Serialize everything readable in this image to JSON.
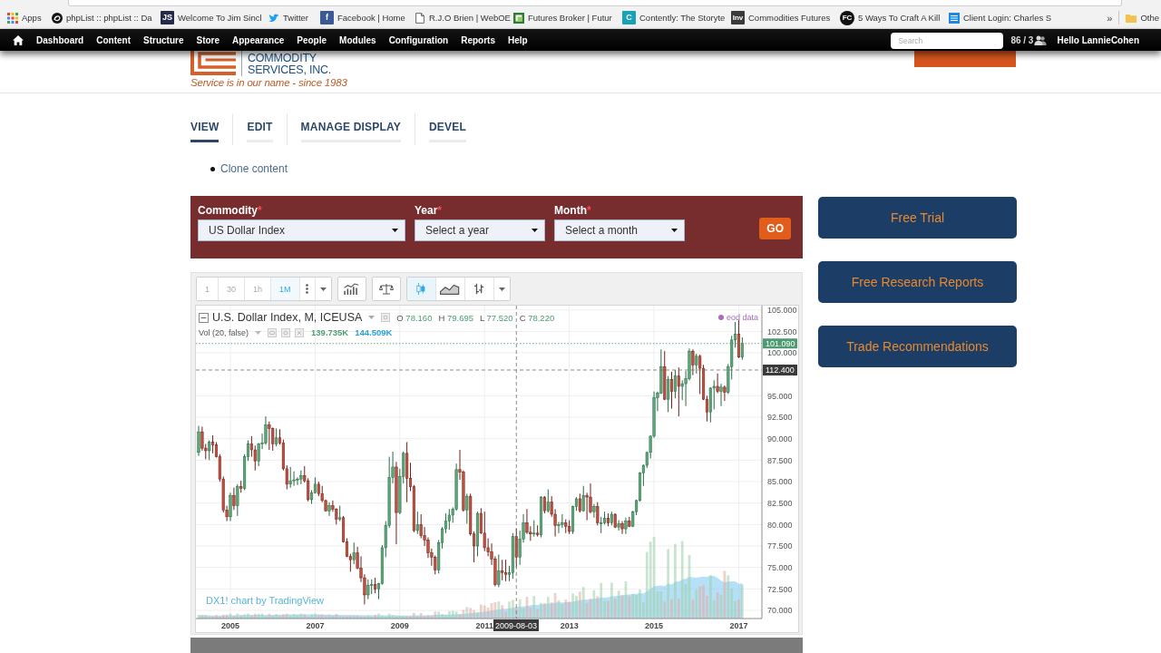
{
  "browser": {
    "bookmarks": [
      {
        "label": "Apps"
      },
      {
        "label": "phpList :: phpList :: Da"
      },
      {
        "label": "Welcome To Jim Sincl",
        "badge": "JS"
      },
      {
        "label": "Twitter"
      },
      {
        "label": "Facebook | Home",
        "badge": "f"
      },
      {
        "label": "R.J.O Brien | WebOE"
      },
      {
        "label": "Futures Broker | Futur"
      },
      {
        "label": "Contently: The Storyte",
        "badge": "C"
      },
      {
        "label": "Commodities Futures",
        "badge": "Inv"
      },
      {
        "label": "5 Ways To Craft A Kill",
        "badge": "FC"
      },
      {
        "label": "Client Login: Charles S"
      }
    ],
    "overflow": "»",
    "other_bookmarks": "Othe"
  },
  "admin_toolbar": {
    "items": [
      "Dashboard",
      "Content",
      "Structure",
      "Store",
      "Appearance",
      "People",
      "Modules",
      "Configuration",
      "Reports",
      "Help"
    ],
    "search": {
      "placeholder": "Search"
    },
    "online_count": "86 / 3",
    "greeting": "Hello LannieCohen"
  },
  "header": {
    "logo": {
      "name_lines": [
        "COMMODITY",
        "SERVICES, INC."
      ],
      "tagline": "Service is in our name - since 1983"
    }
  },
  "tabs": [
    {
      "label": "VIEW",
      "selected": true
    },
    {
      "label": "EDIT",
      "selected": false
    },
    {
      "label": "MANAGE DISPLAY",
      "selected": false
    },
    {
      "label": "DEVEL",
      "selected": false
    }
  ],
  "links": [
    "Clone content"
  ],
  "search_form": {
    "fields": [
      {
        "label": "Commodity",
        "required_mark": "*",
        "value": "US Dollar Index"
      },
      {
        "label": "Year",
        "required_mark": "*",
        "value": "Select a year"
      },
      {
        "label": "Month",
        "required_mark": "*",
        "value": "Select a month"
      }
    ],
    "submit": "GO"
  },
  "sidebar_buttons": [
    "Free Trial",
    "Free Research Reports",
    "Trade Recommendations"
  ],
  "chart_widget": {
    "intervals": [
      {
        "label": "1",
        "selected": false
      },
      {
        "label": "30",
        "selected": false
      },
      {
        "label": "1h",
        "selected": false
      },
      {
        "label": "1M",
        "selected": true
      }
    ],
    "chart_types": [
      {
        "kind": "candles",
        "selected": true
      },
      {
        "kind": "area",
        "selected": false
      },
      {
        "kind": "bars",
        "selected": false
      }
    ],
    "legend": {
      "title": "U.S. Dollar Index, M, ICEUSA",
      "ohlc": [
        {
          "label": "O",
          "value": "78.160"
        },
        {
          "label": "H",
          "value": "79.695"
        },
        {
          "label": "L",
          "value": "77.520"
        },
        {
          "label": "C",
          "value": "78.220"
        }
      ]
    },
    "volume": {
      "label": "Vol (20, false)",
      "values": [
        {
          "value": "139.735K",
          "color": "#4f9d70"
        },
        {
          "value": "144.509K",
          "color": "#2a9fd8"
        }
      ]
    },
    "data_source": {
      "label": "eod data",
      "color": "#a66bbd"
    },
    "attribution": "DX1! chart by TradingView",
    "crosshair": {
      "price_label": "112.400",
      "date_label": "2009-08-03"
    },
    "chart_data": [
      {
        "type": "candlestick",
        "grid": true,
        "xlim": [
          "2004-03-08",
          "2017-07-18"
        ],
        "ylim": [
          69.05,
          105.5
        ],
        "xticks": [
          {
            "value": "2005-01-01",
            "label": "2005"
          },
          {
            "value": "2007-01-01",
            "label": "2007"
          },
          {
            "value": "2009-01-01",
            "label": "2009"
          },
          {
            "value": "2011-01-01",
            "label": "2011"
          },
          {
            "value": "2013-01-01",
            "label": "2013"
          },
          {
            "value": "2015-01-01",
            "label": "2015"
          },
          {
            "value": "2017-01-01",
            "label": "2017"
          }
        ],
        "yticks": [
          {
            "value": 70,
            "label": "70.000"
          },
          {
            "value": 72.5,
            "label": "72.500"
          },
          {
            "value": 75,
            "label": "75.000"
          },
          {
            "value": 77.5,
            "label": "77.500"
          },
          {
            "value": 80,
            "label": "80.000"
          },
          {
            "value": 82.5,
            "label": "82.500"
          },
          {
            "value": 85,
            "label": "85.000"
          },
          {
            "value": 87.5,
            "label": "87.500"
          },
          {
            "value": 90,
            "label": "90.000"
          },
          {
            "value": 92.5,
            "label": "92.500"
          },
          {
            "value": 95,
            "label": "95.000"
          },
          {
            "value": 100,
            "label": "100.000"
          },
          {
            "value": 102.5,
            "label": "102.500"
          },
          {
            "value": 105,
            "label": "105.000"
          }
        ],
        "ref_lines": [
          {
            "axis": "y",
            "value": 101.09,
            "label": "101.090",
            "color": "#4e9b73",
            "line_style": "dotted"
          },
          {
            "axis": "y",
            "value": 98,
            "color": "#777777",
            "line_style": "dashed"
          },
          {
            "axis": "x",
            "value": "2011-10-01",
            "color": "#777777",
            "line_style": "dashed"
          }
        ],
        "x": [
          "2004-04-01",
          "2004-05-01",
          "2004-06-01",
          "2004-07-01",
          "2004-08-01",
          "2004-09-01",
          "2004-10-01",
          "2004-11-01",
          "2004-12-01",
          "2005-01-01",
          "2005-02-01",
          "2005-03-01",
          "2005-04-01",
          "2005-05-01",
          "2005-06-01",
          "2005-07-01",
          "2005-08-01",
          "2005-09-01",
          "2005-10-01",
          "2005-11-01",
          "2005-12-01",
          "2006-01-01",
          "2006-02-01",
          "2006-03-01",
          "2006-04-01",
          "2006-05-01",
          "2006-06-01",
          "2006-07-01",
          "2006-08-01",
          "2006-09-01",
          "2006-10-01",
          "2006-11-01",
          "2006-12-01",
          "2007-01-01",
          "2007-02-01",
          "2007-03-01",
          "2007-04-01",
          "2007-05-01",
          "2007-06-01",
          "2007-07-01",
          "2007-08-01",
          "2007-09-01",
          "2007-10-01",
          "2007-11-01",
          "2007-12-01",
          "2008-01-01",
          "2008-02-01",
          "2008-03-01",
          "2008-04-01",
          "2008-05-01",
          "2008-06-01",
          "2008-07-01",
          "2008-08-01",
          "2008-09-01",
          "2008-10-01",
          "2008-11-01",
          "2008-12-01",
          "2009-01-01",
          "2009-02-01",
          "2009-03-01",
          "2009-04-01",
          "2009-05-01",
          "2009-06-01",
          "2009-07-01",
          "2009-08-01",
          "2009-09-01",
          "2009-10-01",
          "2009-11-01",
          "2009-12-01",
          "2010-01-01",
          "2010-02-01",
          "2010-03-01",
          "2010-04-01",
          "2010-05-01",
          "2010-06-01",
          "2010-07-01",
          "2010-08-01",
          "2010-09-01",
          "2010-10-01",
          "2010-11-01",
          "2010-12-01",
          "2011-01-01",
          "2011-02-01",
          "2011-03-01",
          "2011-04-01",
          "2011-05-01",
          "2011-06-01",
          "2011-07-01",
          "2011-08-01",
          "2011-09-01",
          "2011-10-01",
          "2011-11-01",
          "2011-12-01",
          "2012-01-01",
          "2012-02-01",
          "2012-03-01",
          "2012-04-01",
          "2012-05-01",
          "2012-06-01",
          "2012-07-01",
          "2012-08-01",
          "2012-09-01",
          "2012-10-01",
          "2012-11-01",
          "2012-12-01",
          "2013-01-01",
          "2013-02-01",
          "2013-03-01",
          "2013-04-01",
          "2013-05-01",
          "2013-06-01",
          "2013-07-01",
          "2013-08-01",
          "2013-09-01",
          "2013-10-01",
          "2013-11-01",
          "2013-12-01",
          "2014-01-01",
          "2014-02-01",
          "2014-03-01",
          "2014-04-01",
          "2014-05-01",
          "2014-06-01",
          "2014-07-01",
          "2014-08-01",
          "2014-09-01",
          "2014-10-01",
          "2014-11-01",
          "2014-12-01",
          "2015-01-01",
          "2015-02-01",
          "2015-03-01",
          "2015-04-01",
          "2015-05-01",
          "2015-06-01",
          "2015-07-01",
          "2015-08-01",
          "2015-09-01",
          "2015-10-01",
          "2015-11-01",
          "2015-12-01",
          "2016-01-01",
          "2016-02-01",
          "2016-03-01",
          "2016-04-01",
          "2016-05-01",
          "2016-06-01",
          "2016-07-01",
          "2016-08-01",
          "2016-09-01",
          "2016-10-01",
          "2016-11-01",
          "2016-12-01",
          "2017-01-01",
          "2017-02-01"
        ],
        "ohlc": [
          [
            88.4,
            91.5,
            88.0,
            90.8
          ],
          [
            90.8,
            91.4,
            88.6,
            88.9
          ],
          [
            88.9,
            89.4,
            87.6,
            88.6
          ],
          [
            88.6,
            89.8,
            87.5,
            89.6
          ],
          [
            89.6,
            90.4,
            88.3,
            89.3
          ],
          [
            89.3,
            89.6,
            87.8,
            87.9
          ],
          [
            87.9,
            88.2,
            85.0,
            85.3
          ],
          [
            85.3,
            85.6,
            81.4,
            81.7
          ],
          [
            81.7,
            82.2,
            80.4,
            80.9
          ],
          [
            80.9,
            83.7,
            80.4,
            83.4
          ],
          [
            83.4,
            84.3,
            81.7,
            82.2
          ],
          [
            82.2,
            84.7,
            81.0,
            84.4
          ],
          [
            84.4,
            85.1,
            83.7,
            84.2
          ],
          [
            84.2,
            88.2,
            84.0,
            87.9
          ],
          [
            87.9,
            89.8,
            87.4,
            89.4
          ],
          [
            89.4,
            90.3,
            87.9,
            88.7
          ],
          [
            88.7,
            89.2,
            86.3,
            87.4
          ],
          [
            87.4,
            89.5,
            86.8,
            89.4
          ],
          [
            89.4,
            90.6,
            88.8,
            89.5
          ],
          [
            89.5,
            92.6,
            89.3,
            91.6
          ],
          [
            91.6,
            92.0,
            88.7,
            91.2
          ],
          [
            91.2,
            91.3,
            88.6,
            89.4
          ],
          [
            89.4,
            91.2,
            89.1,
            90.1
          ],
          [
            90.1,
            91.1,
            89.3,
            89.5
          ],
          [
            89.5,
            89.9,
            86.3,
            86.5
          ],
          [
            86.5,
            86.9,
            84.1,
            84.7
          ],
          [
            84.7,
            86.7,
            84.3,
            85.1
          ],
          [
            85.1,
            86.2,
            84.5,
            85.2
          ],
          [
            85.2,
            85.5,
            84.6,
            85.3
          ],
          [
            85.3,
            86.3,
            84.7,
            85.7
          ],
          [
            85.7,
            86.8,
            84.9,
            85.1
          ],
          [
            85.1,
            85.4,
            82.7,
            82.9
          ],
          [
            82.9,
            84.0,
            82.4,
            83.7
          ],
          [
            83.7,
            85.5,
            83.6,
            84.7
          ],
          [
            84.7,
            85.0,
            83.3,
            83.6
          ],
          [
            83.6,
            84.5,
            82.6,
            82.8
          ],
          [
            82.8,
            82.9,
            81.5,
            81.6
          ],
          [
            81.6,
            82.6,
            81.0,
            82.2
          ],
          [
            82.2,
            82.8,
            81.5,
            81.8
          ],
          [
            81.8,
            81.9,
            80.0,
            80.6
          ],
          [
            80.6,
            82.2,
            80.4,
            80.8
          ],
          [
            80.8,
            81.0,
            77.9,
            78.0
          ],
          [
            78.0,
            78.4,
            76.2,
            76.3
          ],
          [
            76.3,
            76.6,
            74.5,
            75.9
          ],
          [
            75.9,
            77.9,
            75.4,
            76.7
          ],
          [
            76.7,
            77.4,
            74.8,
            74.9
          ],
          [
            74.9,
            76.3,
            73.3,
            73.8
          ],
          [
            73.8,
            74.2,
            70.7,
            71.8
          ],
          [
            71.8,
            73.6,
            71.3,
            72.9
          ],
          [
            72.9,
            73.6,
            71.9,
            73.0
          ],
          [
            73.0,
            73.8,
            72.0,
            72.5
          ],
          [
            72.5,
            73.2,
            71.3,
            73.1
          ],
          [
            73.1,
            77.6,
            73.0,
            77.3
          ],
          [
            77.3,
            80.4,
            76.2,
            79.9
          ],
          [
            79.9,
            87.9,
            79.6,
            85.5
          ],
          [
            85.5,
            88.5,
            84.8,
            86.7
          ],
          [
            86.7,
            87.3,
            77.7,
            81.4
          ],
          [
            81.4,
            86.5,
            81.2,
            85.6
          ],
          [
            85.6,
            88.5,
            84.8,
            88.3
          ],
          [
            88.3,
            89.6,
            82.6,
            85.4
          ],
          [
            85.4,
            87.2,
            83.9,
            84.4
          ],
          [
            84.4,
            84.6,
            79.1,
            79.3
          ],
          [
            79.3,
            81.5,
            78.9,
            80.0
          ],
          [
            80.0,
            81.2,
            78.4,
            78.7
          ],
          [
            78.7,
            79.7,
            77.5,
            78.2
          ],
          [
            78.2,
            78.5,
            76.1,
            76.7
          ],
          [
            76.7,
            77.2,
            75.2,
            76.2
          ],
          [
            76.2,
            76.4,
            74.2,
            74.7
          ],
          [
            74.7,
            78.2,
            74.3,
            77.9
          ],
          [
            77.9,
            79.7,
            77.2,
            79.5
          ],
          [
            79.5,
            81.3,
            79.0,
            80.4
          ],
          [
            80.4,
            81.8,
            79.4,
            81.1
          ],
          [
            81.1,
            82.0,
            80.2,
            81.8
          ],
          [
            81.8,
            87.1,
            81.6,
            86.4
          ],
          [
            86.4,
            88.7,
            85.2,
            86.1
          ],
          [
            86.1,
            86.3,
            81.5,
            81.7
          ],
          [
            81.7,
            83.6,
            80.1,
            83.3
          ],
          [
            83.3,
            83.6,
            78.7,
            78.9
          ],
          [
            78.9,
            79.2,
            75.6,
            77.5
          ],
          [
            77.5,
            81.5,
            76.3,
            81.3
          ],
          [
            81.3,
            81.9,
            78.9,
            79.0
          ],
          [
            79.0,
            81.5,
            76.9,
            77.3
          ],
          [
            77.3,
            78.4,
            76.3,
            76.8
          ],
          [
            76.8,
            77.8,
            75.3,
            76.0
          ],
          [
            76.0,
            76.3,
            72.8,
            73.0
          ],
          [
            73.0,
            76.5,
            72.7,
            74.6
          ],
          [
            74.6,
            75.9,
            73.5,
            74.4
          ],
          [
            74.4,
            75.9,
            73.4,
            74.2
          ],
          [
            74.2,
            75.2,
            73.4,
            74.4
          ],
          [
            74.4,
            79.0,
            73.7,
            78.6
          ],
          [
            78.6,
            79.5,
            75.0,
            76.2
          ],
          [
            76.2,
            79.3,
            75.3,
            78.3
          ],
          [
            78.3,
            81.2,
            77.9,
            80.2
          ],
          [
            80.2,
            81.8,
            78.9,
            79.1
          ],
          [
            79.1,
            79.8,
            78.1,
            78.9
          ],
          [
            78.9,
            80.5,
            78.6,
            79.0
          ],
          [
            79.0,
            79.9,
            78.6,
            78.8
          ],
          [
            78.8,
            83.3,
            78.5,
            83.2
          ],
          [
            83.2,
            83.3,
            81.3,
            81.6
          ],
          [
            81.6,
            84.1,
            81.4,
            82.6
          ],
          [
            82.6,
            83.3,
            80.9,
            81.2
          ],
          [
            81.2,
            81.8,
            78.6,
            79.9
          ],
          [
            79.9,
            80.3,
            79.0,
            80.0
          ],
          [
            80.0,
            81.2,
            79.6,
            80.2
          ],
          [
            80.2,
            80.6,
            79.0,
            79.8
          ],
          [
            79.8,
            80.5,
            78.9,
            79.2
          ],
          [
            79.2,
            82.2,
            78.9,
            82.1
          ],
          [
            82.1,
            83.2,
            81.6,
            83.0
          ],
          [
            83.0,
            83.6,
            81.4,
            81.6
          ],
          [
            81.6,
            84.5,
            81.5,
            83.4
          ],
          [
            83.4,
            83.7,
            80.5,
            83.2
          ],
          [
            83.2,
            84.8,
            81.3,
            81.5
          ],
          [
            81.5,
            82.4,
            80.8,
            82.1
          ],
          [
            82.1,
            82.6,
            79.9,
            80.2
          ],
          [
            80.2,
            80.9,
            79.0,
            80.2
          ],
          [
            80.2,
            81.5,
            80.0,
            80.7
          ],
          [
            80.7,
            81.3,
            79.8,
            80.2
          ],
          [
            80.2,
            81.5,
            79.9,
            81.2
          ],
          [
            81.2,
            81.3,
            79.6,
            79.7
          ],
          [
            79.7,
            80.5,
            79.3,
            80.1
          ],
          [
            80.1,
            80.4,
            78.9,
            79.5
          ],
          [
            79.5,
            80.8,
            78.9,
            80.4
          ],
          [
            80.4,
            80.9,
            79.7,
            79.8
          ],
          [
            79.8,
            81.6,
            79.7,
            81.5
          ],
          [
            81.5,
            82.9,
            81.1,
            82.8
          ],
          [
            82.8,
            86.1,
            82.7,
            86.0
          ],
          [
            86.0,
            87.0,
            84.5,
            86.9
          ],
          [
            86.9,
            88.5,
            86.6,
            88.4
          ],
          [
            88.4,
            90.4,
            87.7,
            90.3
          ],
          [
            90.3,
            95.5,
            90.1,
            94.8
          ],
          [
            94.8,
            95.5,
            93.2,
            95.3
          ],
          [
            95.3,
            100.4,
            95.2,
            98.4
          ],
          [
            98.4,
            100.2,
            94.5,
            94.6
          ],
          [
            94.6,
            97.3,
            93.1,
            96.9
          ],
          [
            96.9,
            97.8,
            93.5,
            95.5
          ],
          [
            95.5,
            98.0,
            94.7,
            97.3
          ],
          [
            97.3,
            98.3,
            92.6,
            96.1
          ],
          [
            96.1,
            96.8,
            94.5,
            96.4
          ],
          [
            96.4,
            97.9,
            93.8,
            97.0
          ],
          [
            97.0,
            100.5,
            96.8,
            100.2
          ],
          [
            100.2,
            100.4,
            97.4,
            98.6
          ],
          [
            98.6,
            99.9,
            97.6,
            99.6
          ],
          [
            99.6,
            99.8,
            95.2,
            98.2
          ],
          [
            98.2,
            98.6,
            94.5,
            94.6
          ],
          [
            94.6,
            95.0,
            92.0,
            93.1
          ],
          [
            93.1,
            96.0,
            91.9,
            95.9
          ],
          [
            95.9,
            96.8,
            93.4,
            96.1
          ],
          [
            96.1,
            97.6,
            95.3,
            95.5
          ],
          [
            95.5,
            96.4,
            93.8,
            96.0
          ],
          [
            96.0,
            96.2,
            94.4,
            95.4
          ],
          [
            95.4,
            98.7,
            95.2,
            98.4
          ],
          [
            98.4,
            102.0,
            96.9,
            101.5
          ],
          [
            101.5,
            103.6,
            100.6,
            102.2
          ],
          [
            102.2,
            103.8,
            99.4,
            99.5
          ],
          [
            99.5,
            101.8,
            99.2,
            101.1
          ]
        ]
      }
    ]
  }
}
